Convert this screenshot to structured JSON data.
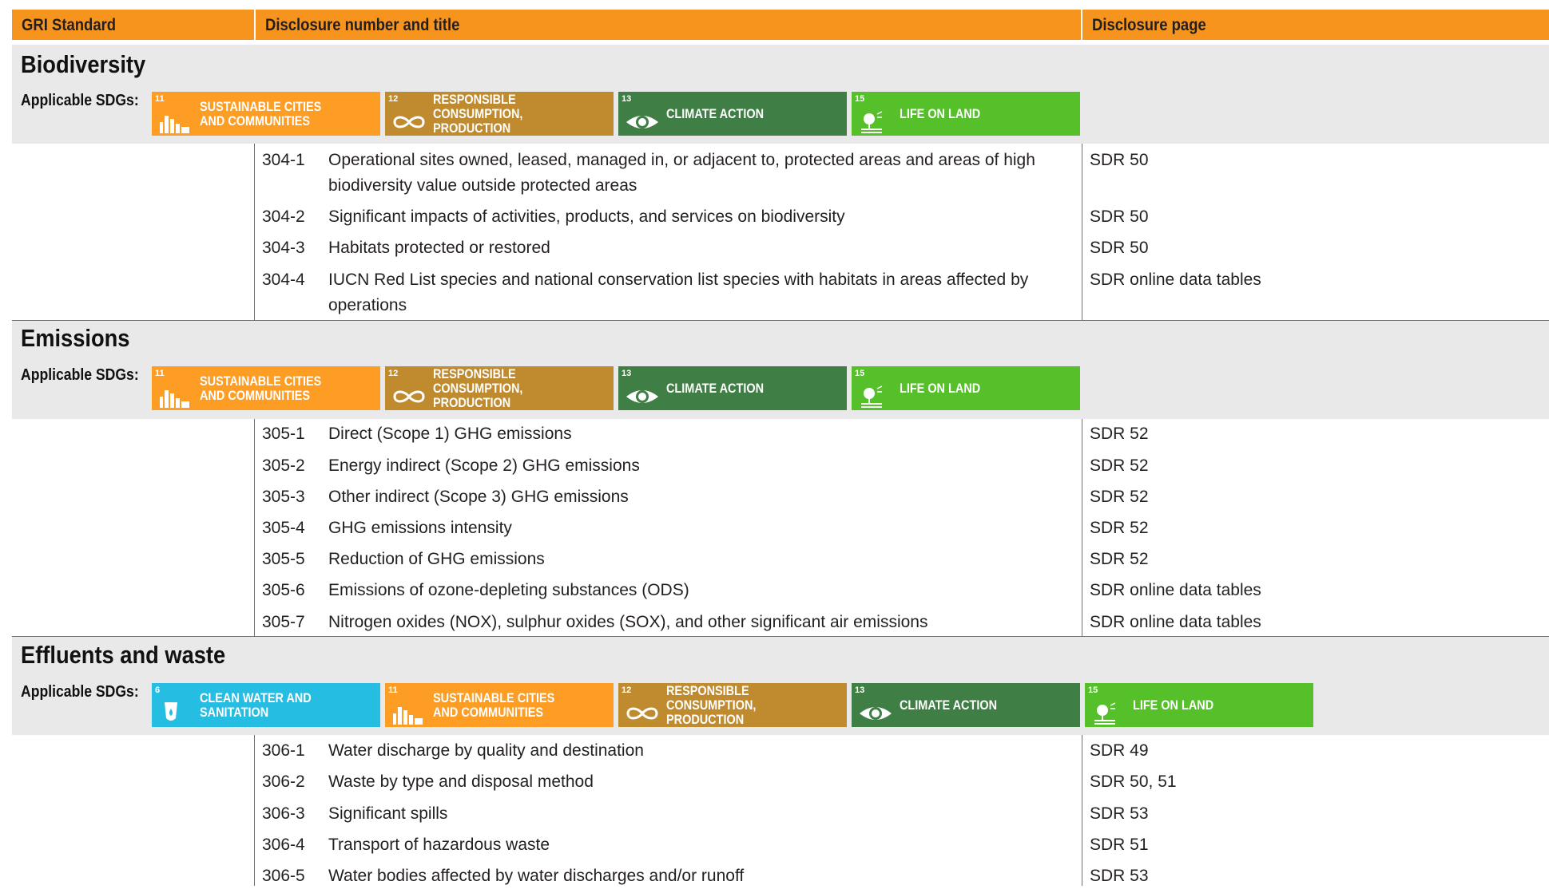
{
  "header": {
    "col1": "GRI Standard",
    "col2": "Disclosure number and title",
    "col3": "Disclosure page"
  },
  "applicable_label": "Applicable SDGs:",
  "sdg_colors": {
    "6": "#26bde2",
    "11": "#fd9d24",
    "12": "#bf8b2e",
    "13": "#3f7e44",
    "15": "#56c02b"
  },
  "sections": [
    {
      "title": "Biodiversity",
      "sdgs": [
        {
          "num": "11",
          "label": "SUSTAINABLE CITIES\nAND COMMUNITIES",
          "icon": "city-icon"
        },
        {
          "num": "12",
          "label": "RESPONSIBLE CONSUMPTION,\nPRODUCTION",
          "icon": "infinity-icon"
        },
        {
          "num": "13",
          "label": "CLIMATE ACTION",
          "icon": "eye-globe-icon"
        },
        {
          "num": "15",
          "label": "LIFE ON LAND",
          "icon": "tree-icon"
        }
      ],
      "rows": [
        {
          "code": "304-1",
          "title": "Operational sites owned, leased, managed in, or adjacent to, protected areas and areas of high biodiversity value outside protected areas",
          "page": "SDR 50"
        },
        {
          "code": "304-2",
          "title": "Significant impacts of activities, products, and services on biodiversity",
          "page": "SDR 50"
        },
        {
          "code": "304-3",
          "title": "Habitats protected or restored",
          "page": "SDR 50"
        },
        {
          "code": "304-4",
          "title": "IUCN Red List species and national conservation list species with habitats in areas affected by operations",
          "page": "SDR online data tables"
        }
      ]
    },
    {
      "title": "Emissions",
      "sdgs": [
        {
          "num": "11",
          "label": "SUSTAINABLE CITIES\nAND COMMUNITIES",
          "icon": "city-icon"
        },
        {
          "num": "12",
          "label": "RESPONSIBLE CONSUMPTION,\nPRODUCTION",
          "icon": "infinity-icon"
        },
        {
          "num": "13",
          "label": "CLIMATE ACTION",
          "icon": "eye-globe-icon"
        },
        {
          "num": "15",
          "label": "LIFE ON LAND",
          "icon": "tree-icon"
        }
      ],
      "rows": [
        {
          "code": "305-1",
          "title": "Direct (Scope 1) GHG emissions",
          "page": "SDR 52"
        },
        {
          "code": "305-2",
          "title": "Energy indirect (Scope 2) GHG emissions",
          "page": "SDR 52"
        },
        {
          "code": "305-3",
          "title": "Other indirect (Scope 3) GHG emissions",
          "page": "SDR 52"
        },
        {
          "code": "305-4",
          "title": "GHG emissions intensity",
          "page": "SDR 52"
        },
        {
          "code": "305-5",
          "title": "Reduction of GHG emissions",
          "page": "SDR 52"
        },
        {
          "code": "305-6",
          "title": "Emissions of ozone-depleting substances (ODS)",
          "page": "SDR online data tables"
        },
        {
          "code": "305-7",
          "title": "Nitrogen oxides (NOX), sulphur oxides (SOX), and other significant air emissions",
          "page": "SDR online data tables"
        }
      ]
    },
    {
      "title": "Effluents and waste",
      "sdgs": [
        {
          "num": "6",
          "label": "CLEAN WATER AND\nSANITATION",
          "icon": "water-drop-icon"
        },
        {
          "num": "11",
          "label": "SUSTAINABLE CITIES\nAND COMMUNITIES",
          "icon": "city-icon"
        },
        {
          "num": "12",
          "label": "RESPONSIBLE CONSUMPTION,\nPRODUCTION",
          "icon": "infinity-icon"
        },
        {
          "num": "13",
          "label": "CLIMATE ACTION",
          "icon": "eye-globe-icon"
        },
        {
          "num": "15",
          "label": "LIFE ON LAND",
          "icon": "tree-icon"
        }
      ],
      "rows": [
        {
          "code": "306-1",
          "title": "Water discharge by quality and destination",
          "page": "SDR 49"
        },
        {
          "code": "306-2",
          "title": "Waste by type and disposal method",
          "page": "SDR 50, 51"
        },
        {
          "code": "306-3",
          "title": "Significant spills",
          "page": "SDR 53"
        },
        {
          "code": "306-4",
          "title": "Transport of hazardous waste",
          "page": "SDR 51"
        },
        {
          "code": "306-5",
          "title": "Water bodies affected by water discharges and/or runoff",
          "page": "SDR 53"
        }
      ]
    }
  ]
}
